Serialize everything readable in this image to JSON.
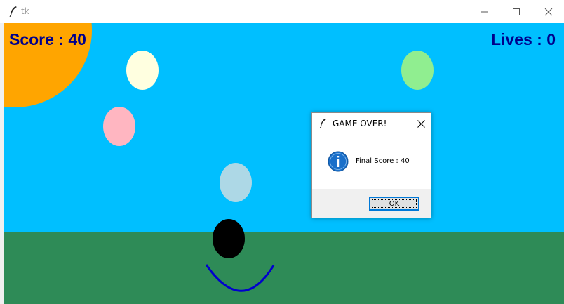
{
  "window": {
    "title": "tk"
  },
  "game": {
    "score_text": "Score : 40",
    "lives_text": "Lives : 0",
    "colors": {
      "sky": "#00bfff",
      "ground": "#2e8b57",
      "sun": "#ffa500",
      "hud_text": "#00008b",
      "head": "#000000",
      "smile": "#0000cd"
    },
    "balloon_colors": [
      "#ffffe0",
      "#90ee90",
      "#ffb6c1",
      "#add8e6"
    ]
  },
  "dialog": {
    "title": "GAME OVER!",
    "message": "Final Score : 40",
    "ok_label": "OK",
    "icon": "info-icon"
  }
}
